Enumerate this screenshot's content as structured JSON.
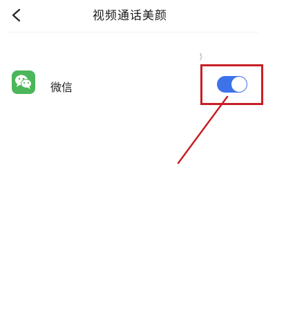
{
  "header": {
    "title": "视频通话美颜",
    "back_icon": "chevron-left-icon"
  },
  "settings": {
    "items": [
      {
        "app_name": "微信",
        "icon": "wechat-icon",
        "icon_color": "#4cb65a",
        "enabled": true
      }
    ]
  },
  "colors": {
    "toggle_on": "#3d72e9",
    "annotation": "#c81e24"
  }
}
